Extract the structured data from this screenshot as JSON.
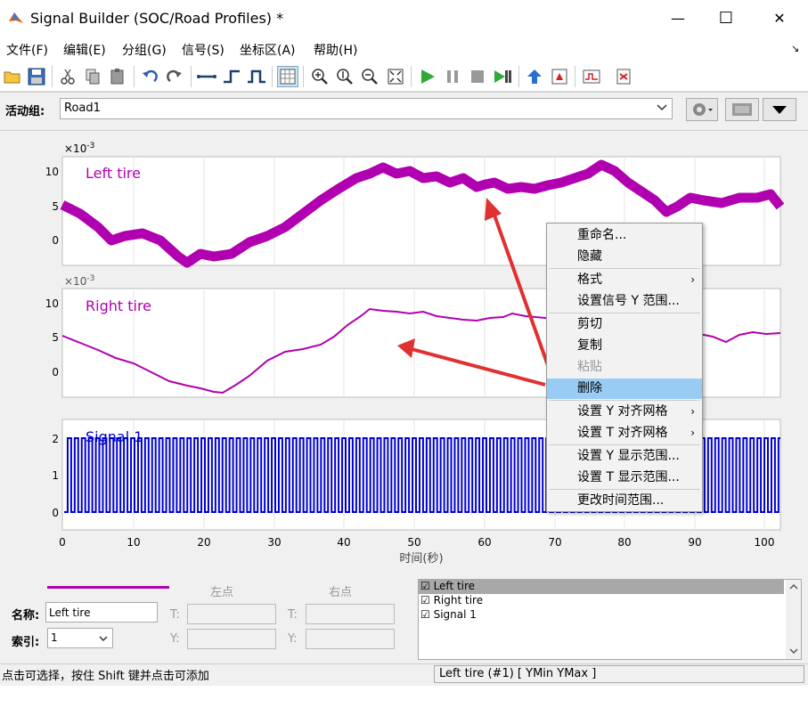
{
  "window": {
    "title": "Signal Builder (SOC/Road Profiles) *",
    "minimize_glyph": "—",
    "maximize_glyph": "☐",
    "close_glyph": "✕"
  },
  "menubar": {
    "items": [
      "文件(F)",
      "编辑(E)",
      "分组(G)",
      "信号(S)",
      "坐标区(A)",
      "帮助(H)"
    ],
    "overflow_glyph": "↘"
  },
  "toolbar": {
    "icons": [
      "open-icon",
      "save-icon",
      "cut-icon",
      "copy-icon",
      "paste-icon",
      "undo-icon",
      "redo-icon",
      "constant-signal-icon",
      "step-signal-icon",
      "pulse-signal-icon",
      "grid-icon",
      "zoom-x-icon",
      "zoom-y-icon",
      "zoom-out-icon",
      "fit-icon",
      "start-icon",
      "pause-icon",
      "stop-icon",
      "run-all-icon",
      "up-icon",
      "verification-icon",
      "simulink-icon",
      "export-icon"
    ]
  },
  "group_bar": {
    "label": "活动组:",
    "selected_group": "Road1"
  },
  "plots": {
    "exponent_label": "×10",
    "exponent_power": "-3",
    "left_tire": {
      "name": "Left tire",
      "yticks": [
        "10",
        "5",
        "0"
      ],
      "color": "#b000b0"
    },
    "right_tire": {
      "name": "Right tire",
      "yticks": [
        "10",
        "5",
        "0"
      ],
      "color": "#b000b0"
    },
    "signal1": {
      "name": "Signal 1",
      "yticks": [
        "2",
        "1",
        "0"
      ],
      "color": "#0000d0"
    },
    "xticks": [
      "0",
      "10",
      "20",
      "30",
      "40",
      "50",
      "60",
      "70",
      "80",
      "90",
      "100"
    ],
    "xlabel": "时间(秒)"
  },
  "context_menu": {
    "items": [
      {
        "label": "重命名...",
        "enabled": true
      },
      {
        "label": "隐藏",
        "enabled": true
      },
      {
        "label": "格式",
        "enabled": true,
        "submenu": true
      },
      {
        "label": "设置信号 Y 范围...",
        "enabled": true
      },
      {
        "label": "剪切",
        "enabled": true
      },
      {
        "label": "复制",
        "enabled": true
      },
      {
        "label": "粘贴",
        "enabled": false
      },
      {
        "label": "删除",
        "enabled": true,
        "highlighted": true
      },
      {
        "label": "设置 Y 对齐网格",
        "enabled": true,
        "submenu": true
      },
      {
        "label": "设置 T 对齐网格",
        "enabled": true,
        "submenu": true
      },
      {
        "label": "设置 Y 显示范围...",
        "enabled": true
      },
      {
        "label": "设置 T 显示范围...",
        "enabled": true
      },
      {
        "label": "更改时间范围...",
        "enabled": true
      }
    ]
  },
  "properties": {
    "name_label": "名称:",
    "name_value": "Left tire",
    "index_label": "索引:",
    "index_value": "1",
    "left_point_label": "左点",
    "right_point_label": "右点",
    "t_label": "T:",
    "y_label": "Y:"
  },
  "signal_list": {
    "items": [
      {
        "label": "☑ Left tire",
        "selected": true
      },
      {
        "label": "☑ Right tire",
        "selected": false
      },
      {
        "label": "☑ Signal 1",
        "selected": false
      }
    ]
  },
  "status": {
    "left": "点击可选择，按住 Shift 键并点击可添加",
    "right": "Left tire (#1)  [ YMin YMax ]"
  }
}
